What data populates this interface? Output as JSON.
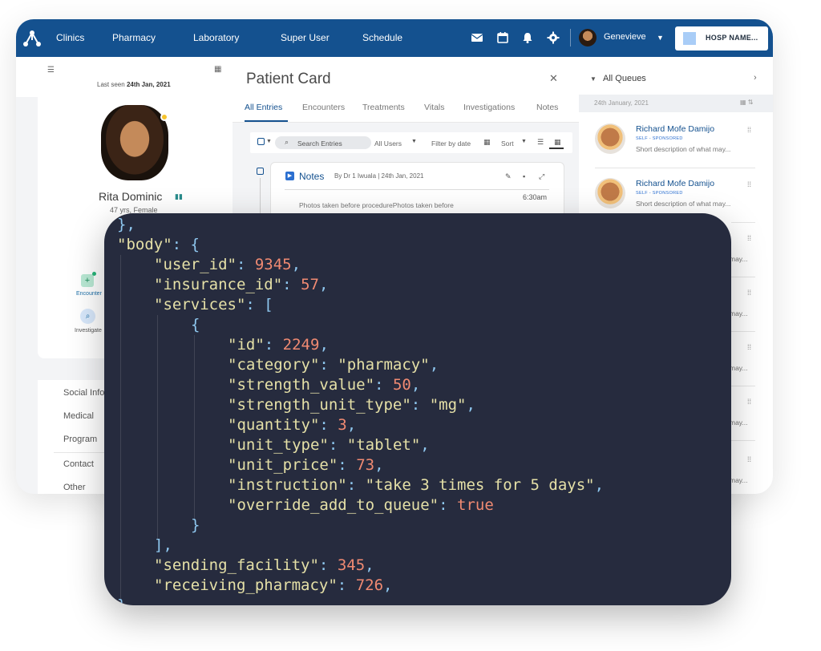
{
  "topbar": {
    "nav": [
      "Clinics",
      "Pharmacy",
      "Laboratory",
      "Super User",
      "Schedule"
    ],
    "icons": [
      "mail-icon",
      "calendar-icon",
      "bell-icon",
      "gear-icon"
    ],
    "user_name": "Genevieve",
    "hospital_label": "HOSP NAME...",
    "color": "#14518f"
  },
  "patient": {
    "last_seen_prefix": "Last seen",
    "last_seen_date": "24th Jan, 2021",
    "name": "Rita Dominic",
    "age_sex": "47 yrs, Female",
    "actions": [
      "Encounter",
      "Investigate"
    ],
    "side_menu": [
      "Social Info",
      "Medical",
      "Program",
      "Contact",
      "Other"
    ]
  },
  "patient_card": {
    "title": "Patient Card",
    "tabs": [
      "All Entries",
      "Encounters",
      "Treatments",
      "Vitals",
      "Investigations",
      "Notes"
    ],
    "toolbar": {
      "search_placeholder": "Search Entries",
      "users": "All Users",
      "filter": "Filter by date",
      "sort": "Sort"
    },
    "note": {
      "title": "Notes",
      "meta": "By Dr 1 Iwuala | 24th Jan, 2021",
      "time": "6:30am",
      "body": "Photos taken before procedurePhotos taken before"
    }
  },
  "queues": {
    "title": "All Queues",
    "date": "24th January, 2021",
    "items": [
      {
        "name": "Richard Mofe Damijo",
        "tag": "SELF - SPONSORED",
        "desc": "Short description of what may..."
      },
      {
        "name": "Richard Mofe Damijo",
        "tag": "SELF - SPONSORED",
        "desc": "Short description of what may..."
      }
    ],
    "partial_desc": [
      "may...",
      "may...",
      "may...",
      "may...",
      "may..."
    ]
  },
  "code": {
    "lines": [
      "},",
      "\"body\": {",
      "\"user_id\": 9345,",
      "\"insurance_id\": 57,",
      "\"services\": [",
      "{",
      "\"id\": 2249,",
      "\"category\": \"pharmacy\",",
      "\"strength_value\": 50,",
      "\"strength_unit_type\": \"mg\",",
      "\"quantity\": 3,",
      "\"unit_type\": \"tablet\",",
      "\"unit_price\": 73,",
      "\"instruction\": \"take 3 times for 5 days\",",
      "\"override_add_to_queue\": true",
      "}",
      "],",
      "\"sending_facility\": 345,",
      "\"receiving_pharmacy\": 726,"
    ]
  }
}
